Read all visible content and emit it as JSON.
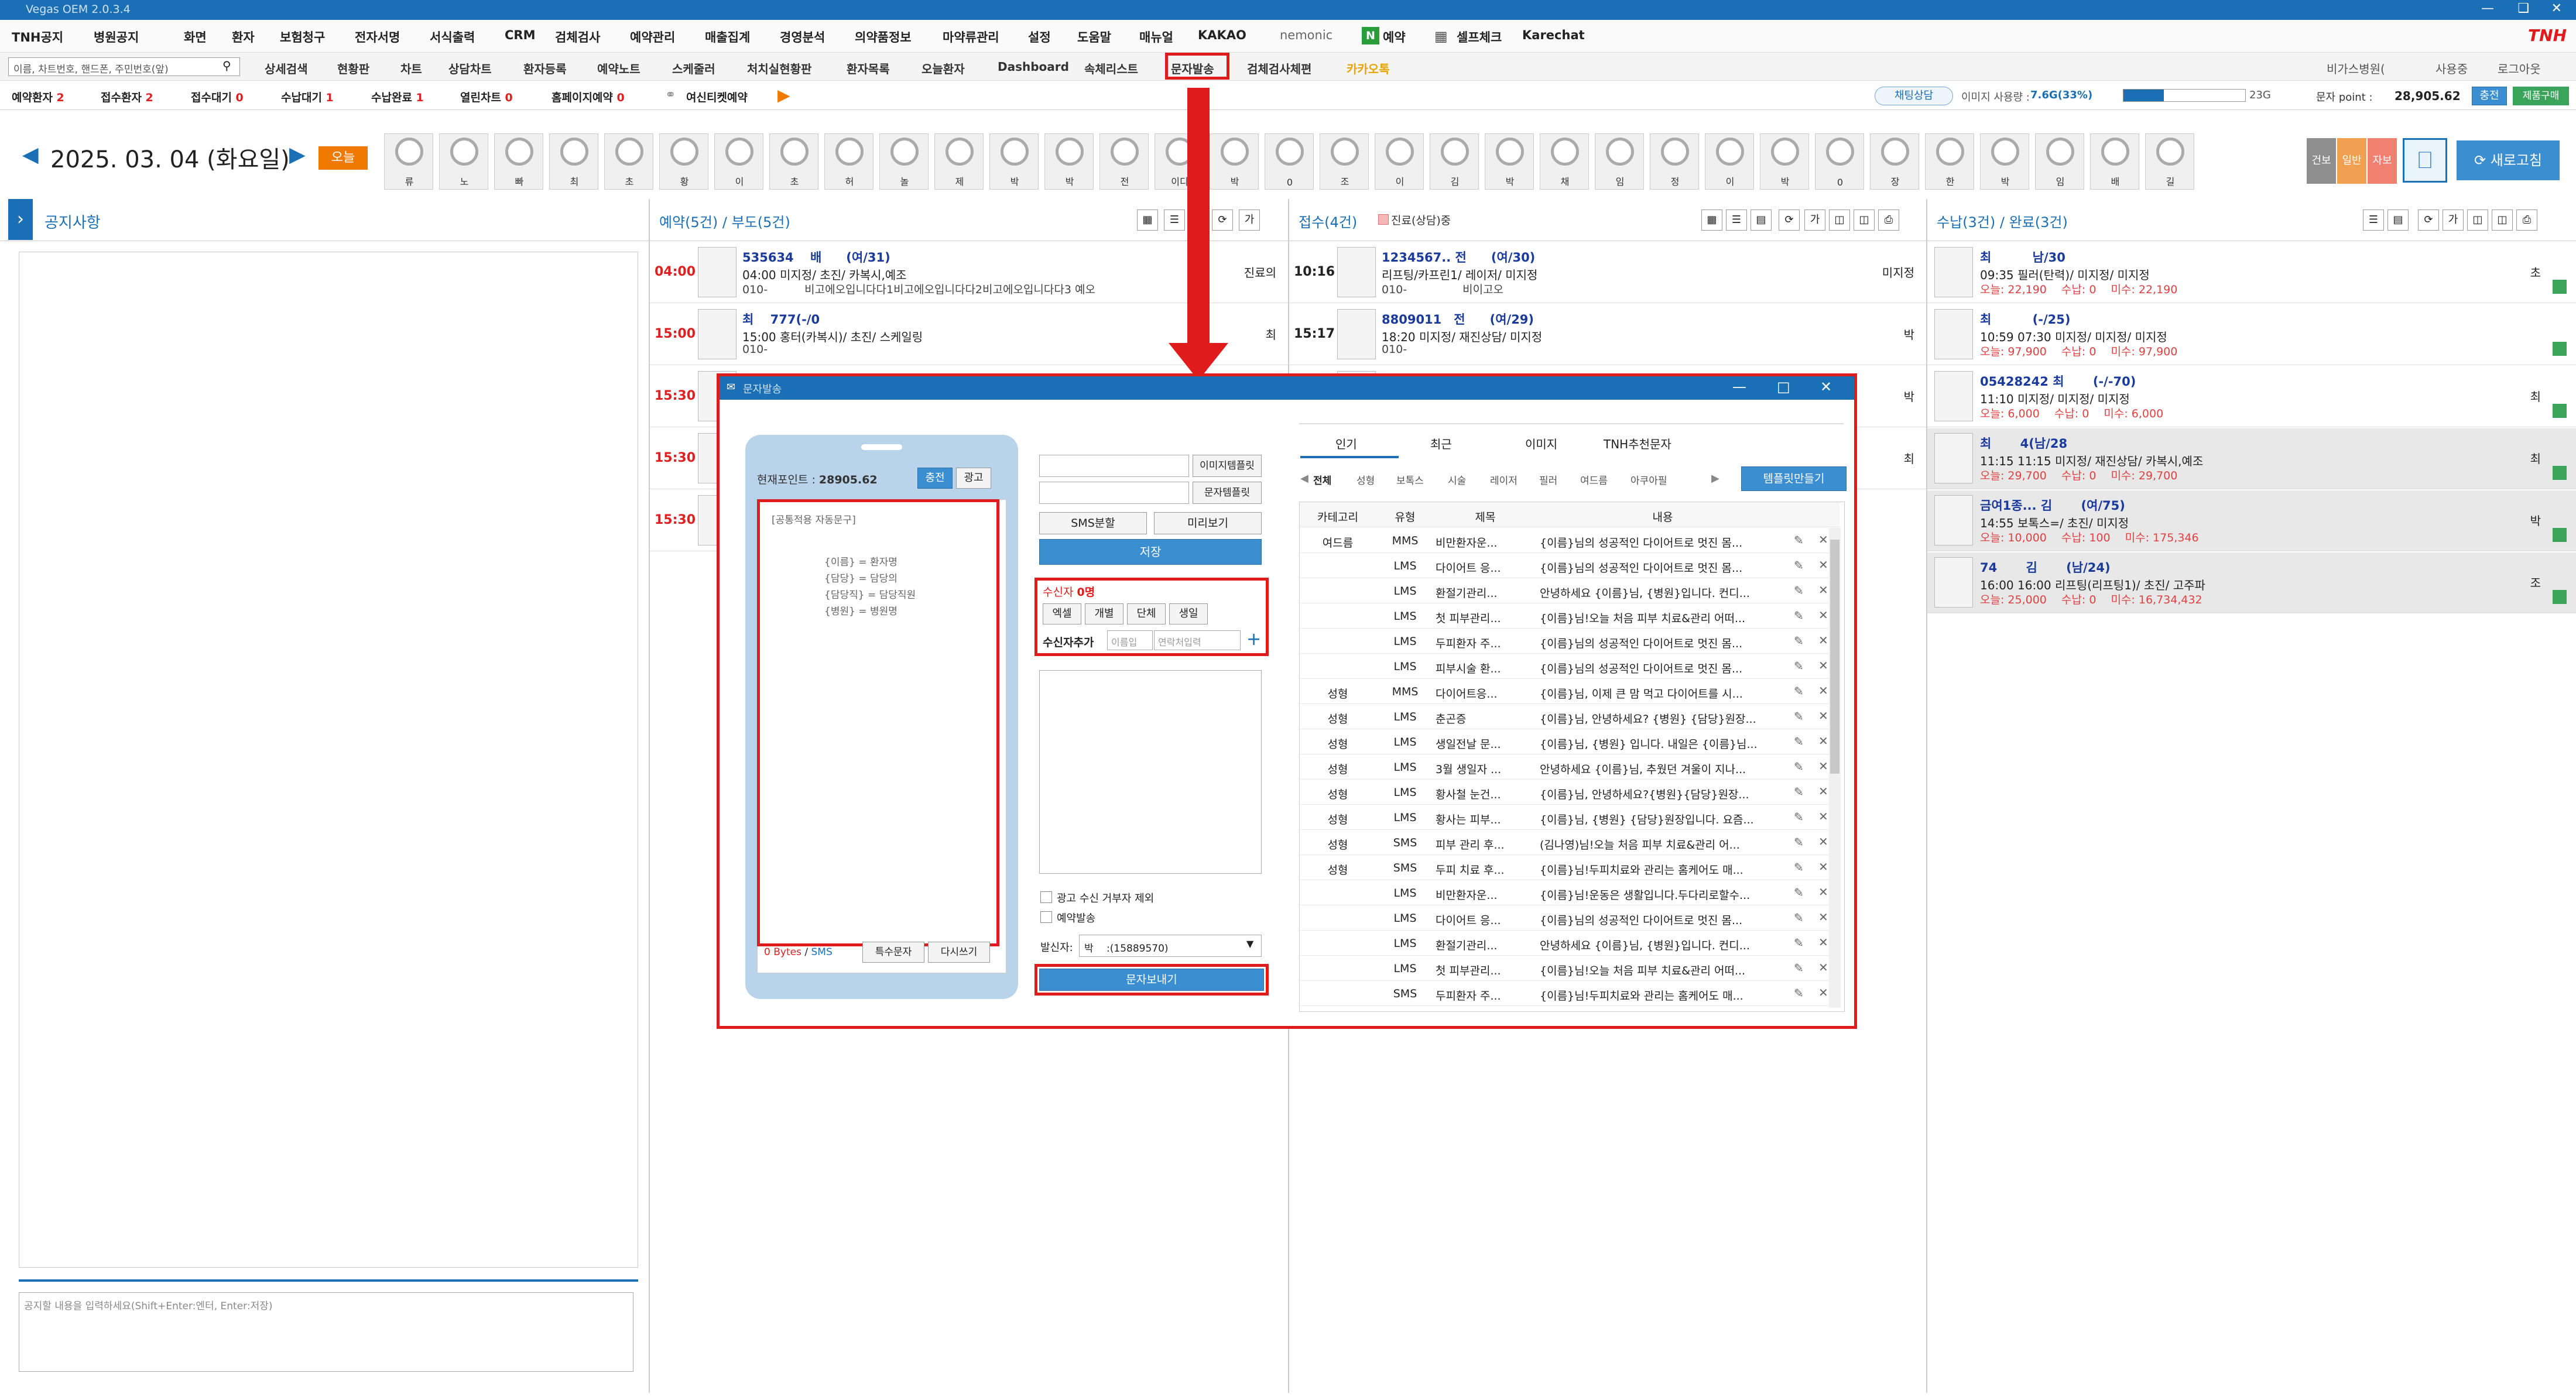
{
  "window": {
    "title": "Vegas OEM 2.0.3.4",
    "brand": "TNH"
  },
  "menu": {
    "left": [
      "TNH공지",
      "병원공지"
    ],
    "items": [
      "화면",
      "환자",
      "보험청구",
      "전자서명",
      "서식출력",
      "CRM",
      "검체검사",
      "예약관리",
      "매출집계",
      "경영분석",
      "의약품정보",
      "마약류관리",
      "설정",
      "도움말",
      "매뉴얼",
      "KAKAO",
      "nemonic",
      "예약",
      "셀프체크",
      "Karechat"
    ]
  },
  "toolbar": {
    "search_placeholder": "이름, 차트번호, 핸드폰, 주민번호(앞)",
    "items": [
      "상세검색",
      "현황판",
      "차트",
      "상담차트",
      "환자등록",
      "예약노트",
      "스케줄러",
      "처치실현황판",
      "환자목록",
      "오늘환자",
      "Dashboard",
      "속체리스트",
      "문자발송",
      "검체검사체편",
      "카카오톡"
    ],
    "right": [
      "비가스병원(",
      "사용중",
      "로그아웃"
    ]
  },
  "status": {
    "items": [
      {
        "label": "예약환자",
        "count": "2"
      },
      {
        "label": "접수환자",
        "count": "2"
      },
      {
        "label": "접수대기",
        "count": "0"
      },
      {
        "label": "수납대기",
        "count": "1"
      },
      {
        "label": "수납완료",
        "count": "1"
      },
      {
        "label": "열린차트",
        "count": "0"
      },
      {
        "label": "홈페이지예약",
        "count": "0"
      }
    ],
    "extra": "여신티켓예약",
    "chat": "채팅상담",
    "image_usage_label": "이미지 사용량 :",
    "image_usage": "7.6G(33%)",
    "image_usage_pct": 33,
    "image_total": "23G",
    "sms_label": "문자 point :",
    "sms_point": "28,905.62",
    "charge": "충전",
    "buy": "제품구매"
  },
  "date": {
    "text": "2025. 03. 04 (화요일)",
    "today": "오늘"
  },
  "staff": [
    "류",
    "노",
    "빠",
    "최",
    "초",
    "황",
    "이",
    "초",
    "허",
    "놀",
    "제",
    "박",
    "박",
    "전",
    "이디",
    "박",
    "0",
    "조",
    "이",
    "김",
    "박",
    "채",
    "임",
    "정",
    "이",
    "박",
    "0",
    "장",
    "한",
    "박",
    "임",
    "배",
    "길"
  ],
  "top_right": {
    "labels": [
      "건보",
      "일반",
      "자보"
    ],
    "refresh": "새로고침"
  },
  "notice": {
    "title": "공지사항",
    "input_placeholder": "공지할 내용을 입력하세요(Shift+Enter:엔터, Enter:저장)"
  },
  "reservation": {
    "title": "예약(5건) / 부도(5건)",
    "rows": [
      {
        "time": "04:00",
        "l1": "535634 　배　　(여/31)",
        "l2": "04:00 미지정/ 초진/ 카복시,예조",
        "l3": "010-　　　 비고에오입니다다1비고에오입니다다2비고에오입니다다3 예오",
        "status": "진료의"
      },
      {
        "time": "15:00",
        "l1": "최　 777(-/0",
        "l2": "15:00 홍터(카복시)/ 초진/ 스케일링",
        "l3": "010-",
        "status": "최"
      },
      {
        "time": "15:30",
        "l1": "",
        "l2": "",
        "l3": "",
        "status": ""
      },
      {
        "time": "15:30",
        "l1": "",
        "l2": "",
        "l3": "",
        "status": ""
      },
      {
        "time": "15:30",
        "l1": "",
        "l2": "",
        "l3": "",
        "status": ""
      }
    ]
  },
  "reception": {
    "title": "접수(4건)",
    "legend": "진료(상담)중",
    "rows": [
      {
        "time": "10:16",
        "l1": "1234567.. 전　　(여/30)",
        "l2": "리프팅/카프린1/ 레이저/ 미지정",
        "l3": "010-　　　　　비이고오",
        "status": "미지정"
      },
      {
        "time": "15:17",
        "l1": "8809011　전　　(여/29)",
        "l2": "18:20 미지정/ 재진상담/ 미지정",
        "l3": "010-",
        "status": "박"
      },
      {
        "time": "",
        "l1": "",
        "l2": "",
        "l3": "",
        "status": "박"
      },
      {
        "time": "",
        "l1": "",
        "l2": "",
        "l3": "",
        "status": "최"
      }
    ]
  },
  "payment": {
    "title": "수납(3건) / 완료(3건)",
    "rows": [
      {
        "l1": "최　　　 남/30",
        "l2": "09:35 필러(탄력)/ 미지정/ 미지정",
        "l3": "오늘: 22,190　 수납: 0　 미수: 22,190",
        "status": "초"
      },
      {
        "l1": "최　　　 (-/25)",
        "l2": "10:59 07:30 미지정/ 미지정/ 미지정",
        "l3": "오늘: 97,900　 수납: 0　 미수: 97,900",
        "status": ""
      },
      {
        "l1": "05428242 최　　 (-/-70)",
        "l2": "11:10 미지정/ 미지정/ 미지정",
        "l3": "오늘: 6,000　 수납: 0　 미수: 6,000",
        "status": "최"
      },
      {
        "l1": "최　　 4(남/28",
        "l2": "11:15 11:15 미지정/ 재진상담/ 카복시,예조",
        "l3": "오늘: 29,700　 수납: 0　 미수: 29,700",
        "status": "최"
      },
      {
        "l1": "금여1종... 김　　 (여/75)",
        "l2": "14:55 보톡스=/ 초진/ 미지정",
        "l3": "오늘: 10,000　 수납: 100　 미수: 175,346",
        "status": "박"
      },
      {
        "l1": "74　　 김　　 (남/24)",
        "l2": "16:00 16:00 리프팅(리프팅1)/ 초진/ 고주파",
        "l3": "오늘: 25,000　 수납: 0　 미수: 16,734,432",
        "status": "조"
      }
    ]
  },
  "sms_dialog": {
    "title": "문자발송",
    "point_label": "현재포인트 :",
    "point": "28905.62",
    "charge": "충전",
    "ad": "광고",
    "template_text": [
      "[공통적용 자동문구]",
      "{이름} = 환자명",
      "{담당} = 담당의",
      "{담당직} = 담당직원",
      "{병원} = 병원명"
    ],
    "bytes": "0 Bytes",
    "sms_type": "SMS",
    "special": "특수문자",
    "rewrite": "다시쓰기",
    "image_template": "이미지템플릿",
    "text_template": "문자템플릿",
    "split": "SMS분할",
    "preview": "미리보기",
    "save": "저장",
    "recipients_label": "수신자",
    "recipients_count": "0명",
    "recipient_tabs": [
      "엑셀",
      "개별",
      "단체",
      "생일"
    ],
    "add_label": "수신자추가",
    "name_placeholder": "이름입",
    "phone_placeholder": "연락처입력",
    "ad_reject": "광고 수신 거부자 제외",
    "reserve_send": "예약발송",
    "sender_label": "발신자:",
    "sender": "박　 :(15889570)",
    "send": "문자보내기",
    "tabs": [
      "인기",
      "최근",
      "이미지",
      "TNH추천문자"
    ],
    "categories": [
      "전체",
      "성형",
      "보톡스",
      "시술",
      "레이저",
      "필러",
      "여드름",
      "아쿠아필"
    ],
    "make_template": "템플릿만들기",
    "table_headers": [
      "카테고리",
      "유형",
      "제목",
      "내용"
    ],
    "rows": [
      {
        "cat": "여드름",
        "type": "MMS",
        "title": "비만환자운...",
        "content": "{이름}님의 성공적인 다이어트로 멋진 몸..."
      },
      {
        "cat": "",
        "type": "LMS",
        "title": "다이어트 응...",
        "content": "{이름}님의 성공적인 다이어트로 멋진 몸..."
      },
      {
        "cat": "",
        "type": "LMS",
        "title": "환절기관리...",
        "content": "안녕하세요 {이름}님, {병원}입니다. 컨디..."
      },
      {
        "cat": "",
        "type": "LMS",
        "title": "첫 피부관리...",
        "content": "{이름}님!오늘 처음 피부 치료&관리 어떠..."
      },
      {
        "cat": "",
        "type": "LMS",
        "title": "두피환자 주...",
        "content": "{이름}님의 성공적인 다이어트로 멋진 몸..."
      },
      {
        "cat": "",
        "type": "LMS",
        "title": "피부시술 환...",
        "content": "{이름}님의 성공적인 다이어트로 멋진 몸..."
      },
      {
        "cat": "성형",
        "type": "MMS",
        "title": "다이어트응...",
        "content": "{이름}님, 이제 큰 맘 먹고 다이어트를 시..."
      },
      {
        "cat": "성형",
        "type": "LMS",
        "title": "춘곤증",
        "content": "{이름}님, 안녕하세요? {병원} {담당}원장..."
      },
      {
        "cat": "성형",
        "type": "LMS",
        "title": "생일전날 문...",
        "content": "{이름}님, {병원} 입니다. 내일은 {이름}님..."
      },
      {
        "cat": "성형",
        "type": "LMS",
        "title": "3월 생일자 ...",
        "content": "안녕하세요 {이름}님, 추웠던 겨울이 지나..."
      },
      {
        "cat": "성형",
        "type": "LMS",
        "title": "황사철 눈건...",
        "content": "{이름}님, 안녕하세요?{병원}{담당}원장..."
      },
      {
        "cat": "성형",
        "type": "LMS",
        "title": "황사는 피부...",
        "content": "{이름}님, {병원} {담당}원장입니다. 요즘..."
      },
      {
        "cat": "성형",
        "type": "SMS",
        "title": "피부 관리 후...",
        "content": "(김나영)님!오늘 처음 피부 치료&관리 어..."
      },
      {
        "cat": "성형",
        "type": "SMS",
        "title": "두피 치료 후...",
        "content": "{이름}님!두피치료와 관리는 홈케어도 매..."
      },
      {
        "cat": "",
        "type": "LMS",
        "title": "비만환자운...",
        "content": "{이름}님!운동은 생활입니다.두다리로할수..."
      },
      {
        "cat": "",
        "type": "LMS",
        "title": "다이어트 응...",
        "content": "{이름}님의 성공적인 다이어트로 멋진 몸..."
      },
      {
        "cat": "",
        "type": "LMS",
        "title": "환절기관리...",
        "content": "안녕하세요 {이름}님, {병원}입니다. 컨디..."
      },
      {
        "cat": "",
        "type": "LMS",
        "title": "첫 피부관리...",
        "content": "{이름}님!오늘 처음 피부 치료&관리 어떠..."
      },
      {
        "cat": "",
        "type": "SMS",
        "title": "두피환자 주...",
        "content": "{이름}님!두피치료와 관리는 홈케어도 매..."
      }
    ]
  },
  "colors": {
    "accent": "#1a6fb5",
    "highlight": "#e01b1b",
    "button": "#3b8ed0"
  }
}
